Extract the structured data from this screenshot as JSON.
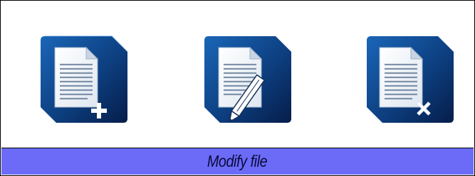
{
  "caption": {
    "text": "Modify file"
  },
  "colors": {
    "caption_bar_bg": "#6b6bf7",
    "caption_text": "#0a0a3c",
    "tile_dark": "#07245a",
    "tile_light": "#1a66b8",
    "page_white": "#ffffff",
    "page_shadow": "#b9c7d8"
  },
  "actions": [
    {
      "name": "add-file",
      "icon": "document-add-icon"
    },
    {
      "name": "edit-file",
      "icon": "document-edit-icon"
    },
    {
      "name": "delete-file",
      "icon": "document-delete-icon"
    }
  ]
}
